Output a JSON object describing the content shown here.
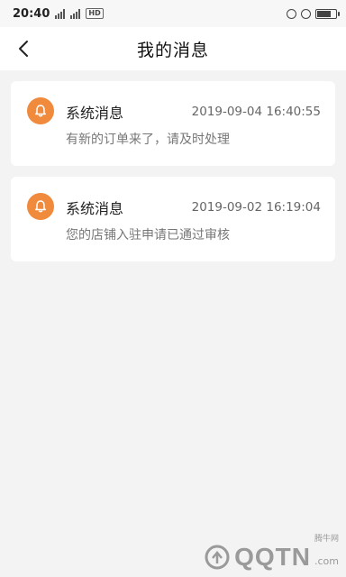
{
  "status_bar": {
    "time": "20:40",
    "network_tag": "HD",
    "battery_icon": "battery-icon"
  },
  "header": {
    "title": "我的消息",
    "back_icon": "chevron-left-icon"
  },
  "messages": [
    {
      "title": "系统消息",
      "time": "2019-09-04 16:40:55",
      "body": "有新的订单来了，请及时处理",
      "icon": "bell-icon"
    },
    {
      "title": "系统消息",
      "time": "2019-09-02 16:19:04",
      "body": "您的店铺入驻申请已通过审核",
      "icon": "bell-icon"
    }
  ],
  "watermark": {
    "small": "腾牛网",
    "text": "QQTN",
    "suffix": ".com"
  },
  "colors": {
    "accent": "#f08a3c",
    "background": "#f3f3f3",
    "card": "#ffffff"
  }
}
